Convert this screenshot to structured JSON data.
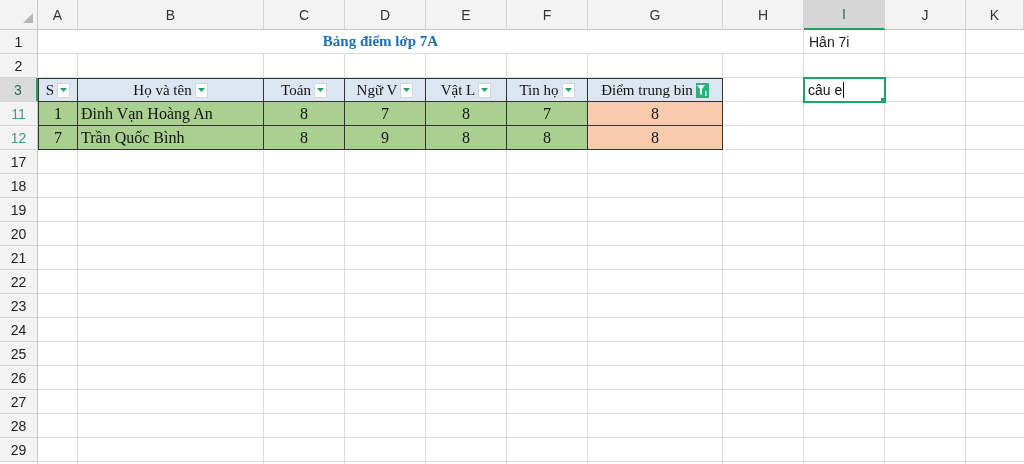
{
  "column_headers": [
    {
      "label": "A",
      "selected": false
    },
    {
      "label": "B",
      "selected": false
    },
    {
      "label": "C",
      "selected": false
    },
    {
      "label": "D",
      "selected": false
    },
    {
      "label": "E",
      "selected": false
    },
    {
      "label": "F",
      "selected": false
    },
    {
      "label": "G",
      "selected": false
    },
    {
      "label": "H",
      "selected": false
    },
    {
      "label": "I",
      "selected": true
    },
    {
      "label": "J",
      "selected": false
    },
    {
      "label": "K",
      "selected": false
    }
  ],
  "row_headers": [
    {
      "label": "1",
      "selected": false,
      "filtered": false
    },
    {
      "label": "2",
      "selected": false,
      "filtered": false
    },
    {
      "label": "3",
      "selected": true,
      "filtered": false
    },
    {
      "label": "11",
      "selected": false,
      "filtered": true
    },
    {
      "label": "12",
      "selected": false,
      "filtered": true
    },
    {
      "label": "17",
      "selected": false,
      "filtered": false
    },
    {
      "label": "18",
      "selected": false,
      "filtered": false
    },
    {
      "label": "19",
      "selected": false,
      "filtered": false
    },
    {
      "label": "20",
      "selected": false,
      "filtered": false
    },
    {
      "label": "21",
      "selected": false,
      "filtered": false
    },
    {
      "label": "22",
      "selected": false,
      "filtered": false
    },
    {
      "label": "23",
      "selected": false,
      "filtered": false
    },
    {
      "label": "24",
      "selected": false,
      "filtered": false
    },
    {
      "label": "25",
      "selected": false,
      "filtered": false
    },
    {
      "label": "26",
      "selected": false,
      "filtered": false
    },
    {
      "label": "27",
      "selected": false,
      "filtered": false
    },
    {
      "label": "28",
      "selected": false,
      "filtered": false
    },
    {
      "label": "29",
      "selected": false,
      "filtered": false
    }
  ],
  "title": "Bảng điểm lớp 7A",
  "note_cell": "Hân 7i",
  "active_cell": {
    "value": "câu e"
  },
  "table": {
    "columns": [
      {
        "label": "S",
        "kind": "index",
        "filtered": false
      },
      {
        "label": "Họ và tên",
        "kind": "name",
        "filtered": false
      },
      {
        "label": "Toán",
        "kind": "score",
        "filtered": false
      },
      {
        "label": "Ngữ V",
        "kind": "score",
        "filtered": false
      },
      {
        "label": "Vật L",
        "kind": "score",
        "filtered": false
      },
      {
        "label": "Tin họ",
        "kind": "score",
        "filtered": false
      },
      {
        "label": "Điểm trung bin",
        "kind": "average",
        "filtered": true
      }
    ],
    "rows": [
      [
        "1",
        "Đinh Vạn Hoàng An",
        "8",
        "7",
        "8",
        "7",
        "8"
      ],
      [
        "7",
        "Trần Quốc Bình",
        "8",
        "9",
        "8",
        "8",
        "8"
      ]
    ]
  }
}
